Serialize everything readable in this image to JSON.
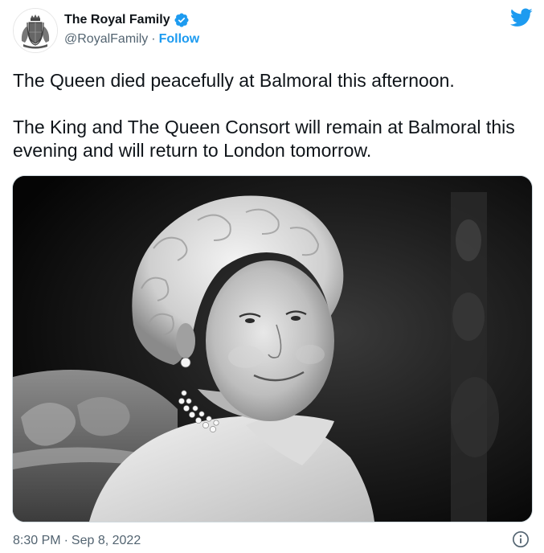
{
  "author": {
    "display_name": "The Royal Family",
    "verified": true,
    "handle": "@RoyalFamily",
    "separator": "·",
    "follow_label": "Follow",
    "avatar_icon": "royal-coat-of-arms"
  },
  "tweet": {
    "paragraphs": [
      "The Queen died peacefully at Balmoral this afternoon.",
      "The King and The Queen Consort will remain at Balmoral this evening and will return to London tomorrow."
    ]
  },
  "media": {
    "type": "black-and-white photograph"
  },
  "footer": {
    "time": "8:30 PM",
    "separator": "·",
    "date": "Sep 8, 2022"
  },
  "icons": {
    "brand": "twitter-bird-icon",
    "info": "info-icon",
    "verified": "verified-badge-icon"
  },
  "colors": {
    "accent": "#1d9bf0",
    "text_primary": "#0f1419",
    "text_secondary": "#536471",
    "border": "#cfd9de"
  }
}
